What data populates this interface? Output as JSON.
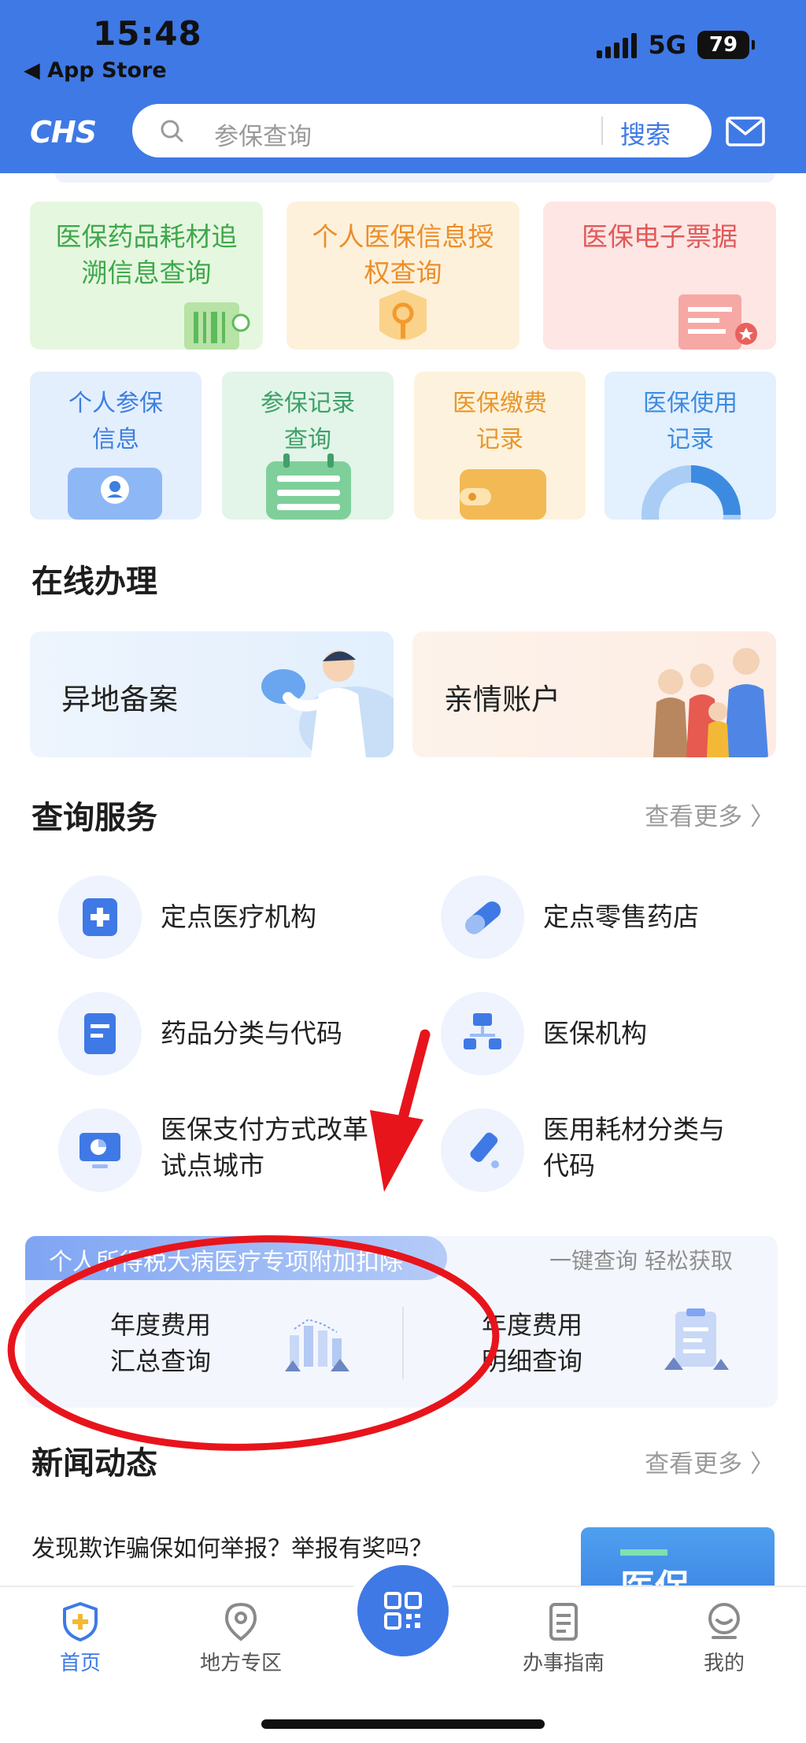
{
  "status_bar": {
    "time": "15:48",
    "back_label": "◀ App Store",
    "network": "5G",
    "battery": "79"
  },
  "header": {
    "logo_text": "CHS",
    "search_placeholder": "参保查询",
    "search_button": "搜索",
    "mail_icon": "mail-icon"
  },
  "tiles_row1": [
    {
      "title": "医保药品耗材追溯信息查询",
      "line1": "医保药品耗材追",
      "line2": "溯信息查询",
      "color": "#3fa84c",
      "bg": "#e6f7df"
    },
    {
      "title": "个人医保信息授权查询",
      "line1": "个人医保信息授",
      "line2": "权查询",
      "color": "#ec8e2a",
      "bg": "#fdf1dc"
    },
    {
      "title": "医保电子票据",
      "line1": "医保电子票据",
      "line2": "",
      "color": "#e05a58",
      "bg": "#fde6e4"
    }
  ],
  "tiles_row2": [
    {
      "line1": "个人参保",
      "line2": "信息",
      "color": "#3d7fe0",
      "bg": "#e4effd"
    },
    {
      "line1": "参保记录",
      "line2": "查询",
      "color": "#3fa06a",
      "bg": "#e2f5e8"
    },
    {
      "line1": "医保缴费",
      "line2": "记录",
      "color": "#e6972c",
      "bg": "#fdf2dd"
    },
    {
      "line1": "医保使用",
      "line2": "记录",
      "color": "#3d8be0",
      "bg": "#e3f0fd"
    }
  ],
  "online": {
    "title": "在线办理",
    "cards": [
      {
        "label": "异地备案"
      },
      {
        "label": "亲情账户"
      }
    ]
  },
  "query": {
    "title": "查询服务",
    "more": "查看更多 〉",
    "items": [
      {
        "line1": "定点医疗机构",
        "line2": ""
      },
      {
        "line1": "定点零售药店",
        "line2": ""
      },
      {
        "line1": "药品分类与代码",
        "line2": ""
      },
      {
        "line1": "医保机构",
        "line2": ""
      },
      {
        "line1": "医保支付方式改革",
        "line2": "试点城市"
      },
      {
        "line1": "医用耗材分类与",
        "line2": "代码"
      }
    ]
  },
  "tax": {
    "tag": "个人所得税大病医疗专项附加扣除",
    "slogan": "一键查询 轻松获取",
    "items": [
      {
        "line1": "年度费用",
        "line2": "汇总查询"
      },
      {
        "line1": "年度费用",
        "line2": "明细查询"
      }
    ]
  },
  "news": {
    "title": "新闻动态",
    "more": "查看更多 〉",
    "headline": "发现欺诈骗保如何举报？举报有奖吗？",
    "thumb_text": "医保"
  },
  "bottom_nav": [
    {
      "label": "首页",
      "active": true
    },
    {
      "label": "地方专区",
      "active": false
    },
    {
      "label": "办事指南",
      "active": false
    },
    {
      "label": "我的",
      "active": false
    }
  ],
  "colors": {
    "brand_blue": "#3f79e6",
    "annotation_red": "#e8141c"
  }
}
